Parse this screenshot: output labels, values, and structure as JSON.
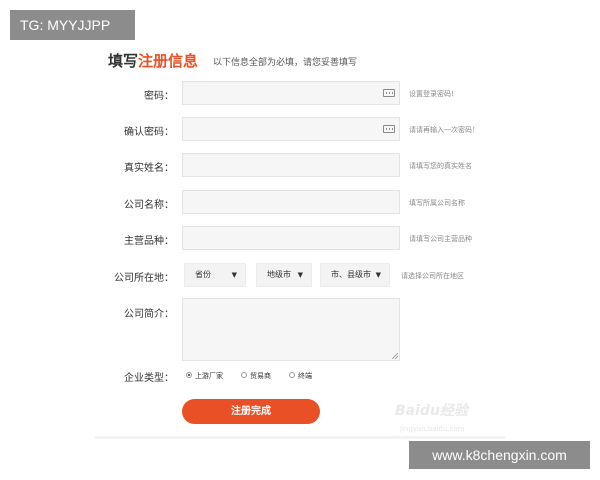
{
  "overlay_tag": "TG: MYYJJPP",
  "site_tag": "www.k8chengxin.com",
  "watermark": "Baidu经验",
  "watermark_sub": "jingyan.baidu.com",
  "header": {
    "title_prefix": "填写",
    "title_accent": "注册信息",
    "subtitle": "以下信息全部为必填，请您妥善填写"
  },
  "form": {
    "password": {
      "label": "密码：",
      "value": "",
      "hint": "设置登录密码!"
    },
    "confirm_password": {
      "label": "确认密码：",
      "value": "",
      "hint": "请请再输入一次密码！"
    },
    "real_name": {
      "label": "真实姓名：",
      "value": "",
      "hint": "请填写您的真实姓名"
    },
    "company_name": {
      "label": "公司名称：",
      "value": "",
      "hint": "填写所属公司名称"
    },
    "main_products": {
      "label": "主营品种：",
      "value": "",
      "hint": "请填写公司主营品种"
    },
    "company_location": {
      "label": "公司所在地：",
      "province": "省份",
      "city": "地级市",
      "county": "市、县级市",
      "arrow": "▼",
      "hint": "请选择公司所在地区"
    },
    "company_intro": {
      "label": "公司简介：",
      "value": ""
    },
    "company_type": {
      "label": "企业类型：",
      "options": [
        "上游厂家",
        "贸易商",
        "终端"
      ],
      "selected": "上游厂家"
    },
    "submit_label": "注册完成"
  },
  "colors": {
    "accent": "#ea5025",
    "input_bg": "#f6f6f6",
    "hint_text": "#8a8a8a"
  }
}
